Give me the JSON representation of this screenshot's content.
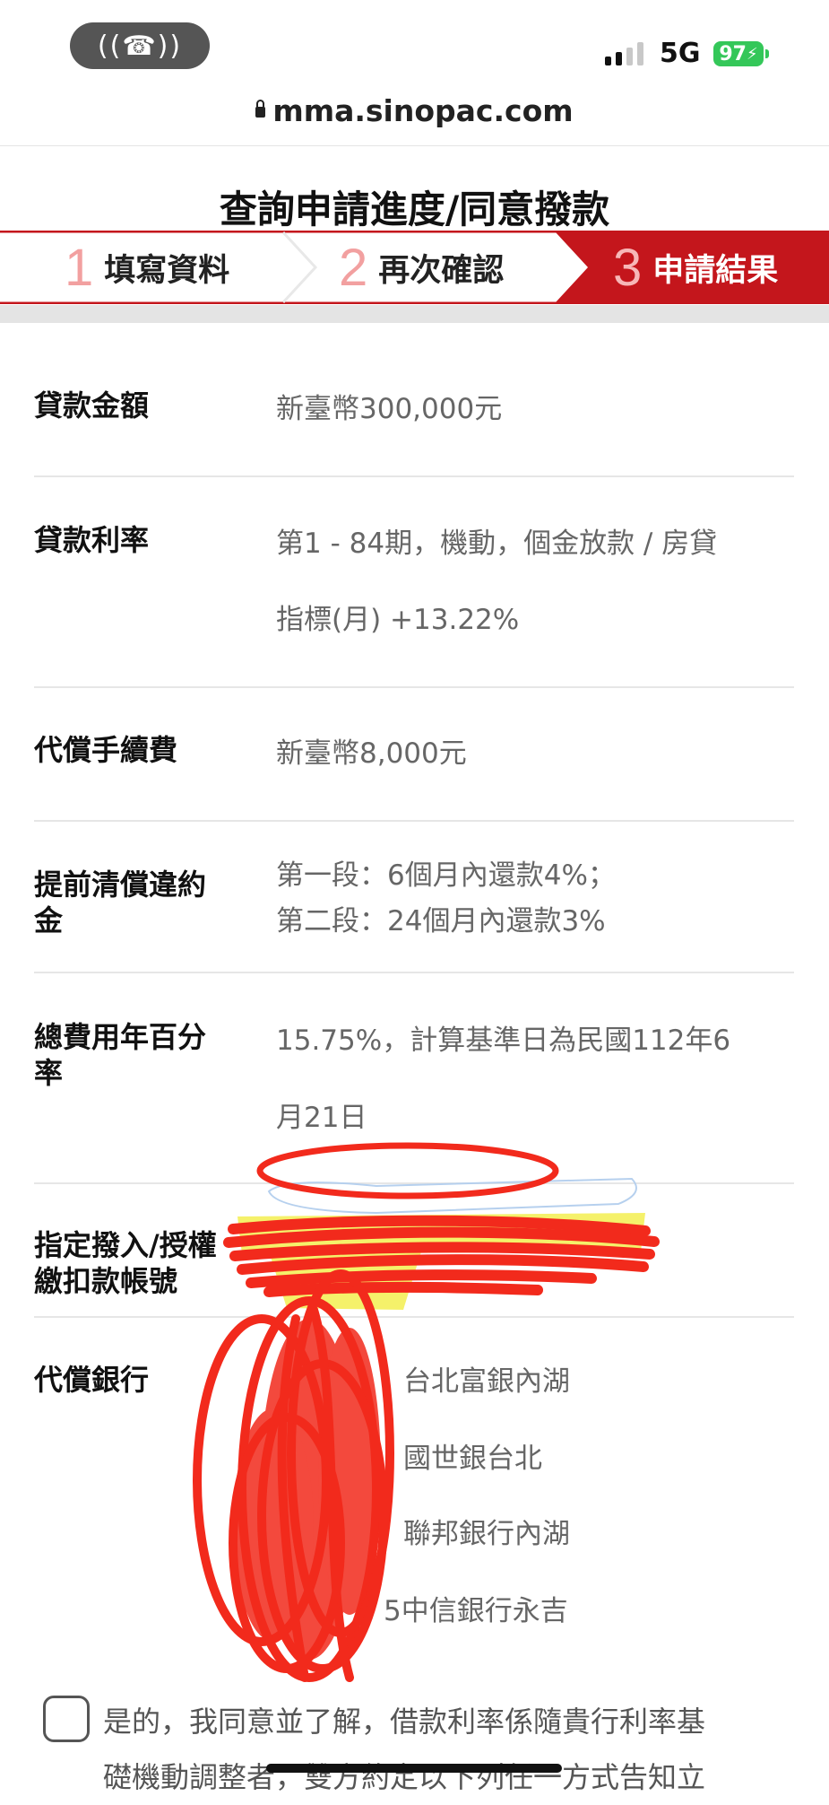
{
  "status_bar": {
    "call_glyph": "((☎))",
    "network": "5G",
    "battery": "97"
  },
  "browser": {
    "url": "mma.sinopac.com"
  },
  "page": {
    "title": "查詢申請進度/同意撥款"
  },
  "steps": [
    {
      "num": "1",
      "label": "填寫資料"
    },
    {
      "num": "2",
      "label": "再次確認"
    },
    {
      "num": "3",
      "label": "申請結果"
    }
  ],
  "details": {
    "loan_amount": {
      "label": "貸款金額",
      "value": "新臺幣300,000元"
    },
    "interest_rate": {
      "label": "貸款利率",
      "value_line1": "第1 - 84期，機動，個金放款 / 房貸",
      "value_line2": "指標(月) +13.22%"
    },
    "fee": {
      "label": "代償手續費",
      "value": "新臺幣8,000元"
    },
    "penalty": {
      "label_line1": "提前清償違約",
      "label_line2": "金",
      "value_line1": "第一段：6個月內還款4%；",
      "value_line2": "第二段：24個月內還款3%"
    },
    "apr": {
      "label_line1": "總費用年百分",
      "label_line2": "率",
      "value_line1": "15.75%，計算基準日為民國112年6",
      "value_line2": "月21日"
    },
    "account": {
      "label_line1": "指定撥入/授權",
      "label_line2": "繳扣款帳號"
    },
    "banks": {
      "label": "代償銀行",
      "items": [
        "台北富銀內湖",
        "國世銀台北",
        "聯邦銀行內湖",
        "5中信銀行永吉"
      ]
    }
  },
  "consent": {
    "line1": "是的，我同意並了解，借款利率係隨貴行利率基",
    "line2": "礎機動調整者，雙方約定以下列任一方式告知立"
  },
  "colors": {
    "brand_red": "#c4161c",
    "step_num_light": "#f2a0a0",
    "scribble_red": "#f22a1c",
    "highlight_yellow": "#f4f05a"
  }
}
